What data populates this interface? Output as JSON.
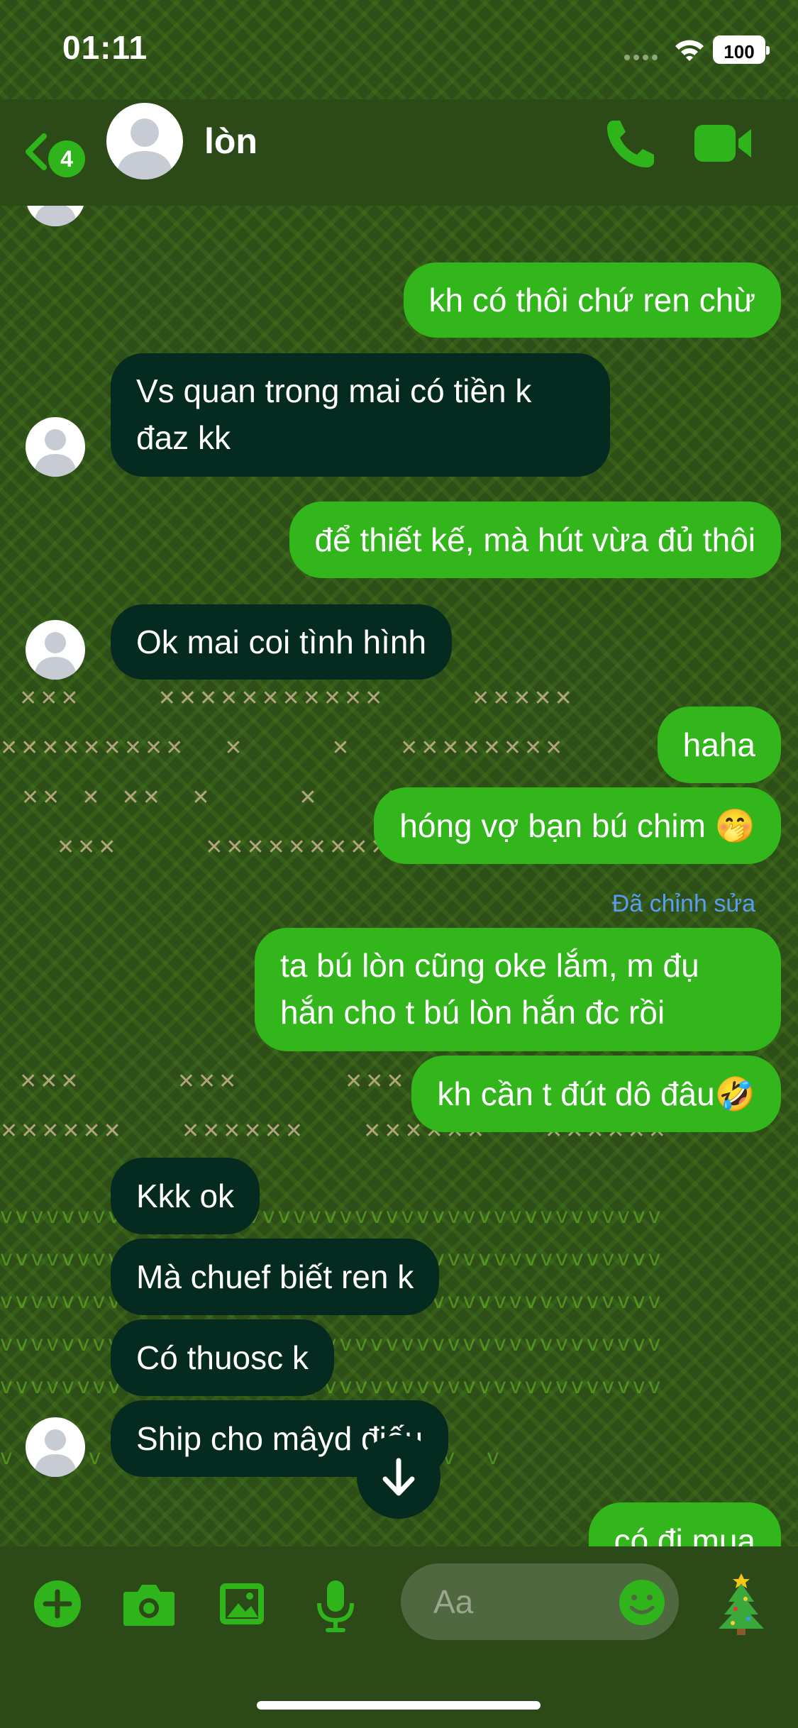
{
  "status_bar": {
    "time": "01:11",
    "battery": "100"
  },
  "header": {
    "back_badge": "4",
    "contact_name": "lòn"
  },
  "messages": [
    {
      "dir": "out",
      "text": "kh có thôi chứ ren chừ"
    },
    {
      "dir": "in",
      "text": "Vs quan trong mai có tiền k đaz kk"
    },
    {
      "dir": "out",
      "text": "để thiết kế, mà hút vừa đủ thôi"
    },
    {
      "dir": "in",
      "text": "Ok mai coi tình hình"
    },
    {
      "dir": "out",
      "text": "haha"
    },
    {
      "dir": "out",
      "text": "hóng vợ bạn bú chim 🤭"
    },
    {
      "dir": "out",
      "text": "ta bú lòn cũng oke lắm, m đụ hắn cho t bú lòn hắn đc rồi"
    },
    {
      "dir": "out",
      "text": "kh cần t đút dô đâu🤣"
    },
    {
      "dir": "in",
      "text": "Kkk ok"
    },
    {
      "dir": "in",
      "text": "Mà chuef biết ren k"
    },
    {
      "dir": "in",
      "text": "Có thuosc k"
    },
    {
      "dir": "in",
      "text": "Ship cho mâyd điếu"
    },
    {
      "dir": "out",
      "text": "có đi mua"
    }
  ],
  "edited_label": "Đã chỉnh sửa",
  "composer": {
    "placeholder": "Aa"
  },
  "icons": {
    "back": "chevron-left-icon",
    "call": "phone-icon",
    "video": "video-camera-icon",
    "add": "plus-circle-icon",
    "camera": "camera-icon",
    "gallery": "image-icon",
    "mic": "microphone-icon",
    "emoji": "smiley-icon",
    "theme": "christmas-tree-icon",
    "scroll_down": "arrow-down-icon"
  },
  "colors": {
    "accent": "#30b41c",
    "outgoing_bubble": "#33b51c",
    "incoming_bubble": "#052a20",
    "edited_label": "#5a9cf0",
    "background": "#2c4a17"
  }
}
